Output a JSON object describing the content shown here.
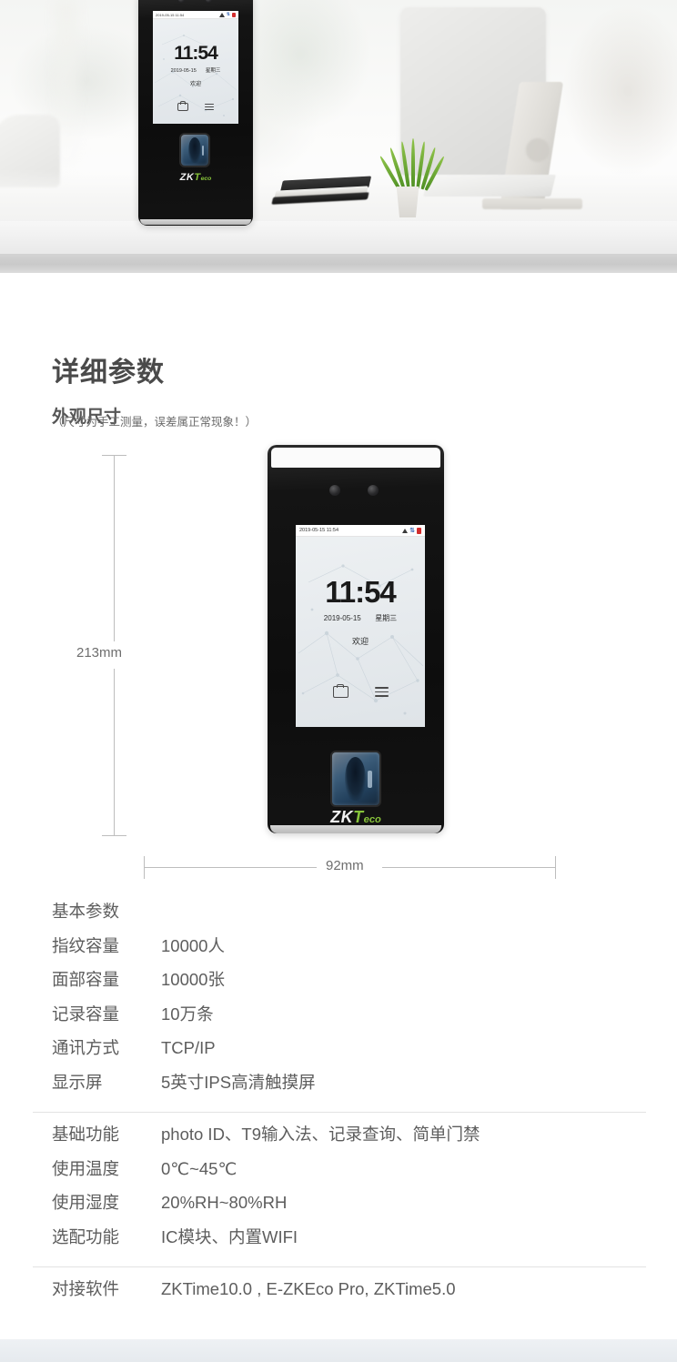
{
  "banner": {
    "alt": "ZKTeco face recognition terminal on white office desk with iMac, plant and notebooks",
    "device_screen": {
      "status_time": "2019-05-15 11:54",
      "time": "11:54",
      "date": "2019-05-15",
      "weekday": "星期三",
      "welcome": "欢迎"
    },
    "logo": {
      "zk": "ZK",
      "t": "T",
      "eco": "eco"
    }
  },
  "section": {
    "title": "详细参数",
    "subtitle": "外观尺寸",
    "note": "（尺寸为手工测量，误差属正常现象！）"
  },
  "dimensions": {
    "height_label": "213mm",
    "width_label": "92mm"
  },
  "device": {
    "screen": {
      "status_time": "2019-05-15 11:54",
      "time": "11:54",
      "date": "2019-05-15",
      "weekday": "星期三",
      "welcome": "欢迎"
    },
    "logo": {
      "zk": "ZK",
      "t": "T",
      "eco": "eco"
    },
    "status_icons": [
      "warning-triangle-icon",
      "network-icon",
      "battery-icon"
    ],
    "nav_icons": [
      "badge-icon",
      "menu-icon"
    ]
  },
  "specs": [
    {
      "rows": [
        {
          "label": "基本参数",
          "value": ""
        },
        {
          "label": "指纹容量",
          "value": "10000人"
        },
        {
          "label": "面部容量",
          "value": "10000张"
        },
        {
          "label": "记录容量",
          "value": "10万条"
        },
        {
          "label": "通讯方式",
          "value": "TCP/IP"
        },
        {
          "label": "显示屏",
          "value": "5英寸IPS高清触摸屏"
        }
      ]
    },
    {
      "rows": [
        {
          "label": "基础功能",
          "value": "photo ID、T9输入法、记录查询、简单门禁"
        },
        {
          "label": "使用温度",
          "value": "0℃~45℃"
        },
        {
          "label": "使用湿度",
          "value": "20%RH~80%RH"
        },
        {
          "label": "选配功能",
          "value": "IC模块、内置WIFI"
        }
      ]
    },
    {
      "rows": [
        {
          "label": "对接软件",
          "value": "ZKTime10.0 , E-ZKEco Pro, ZKTime5.0"
        }
      ]
    }
  ],
  "colors": {
    "text": "#5d5d5d",
    "heading": "#4a4a4a",
    "divider": "#e3e3e3",
    "logo_green": "#86c23a",
    "footer_band": "#e9edf1"
  }
}
